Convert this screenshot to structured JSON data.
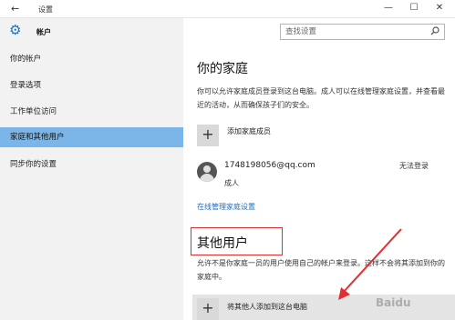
{
  "window": {
    "back_glyph": "←",
    "title": "设置",
    "minimize_glyph": "—",
    "maximize_glyph": "☐",
    "close_glyph": "✕"
  },
  "sidebar": {
    "header_label": "帐户",
    "items": [
      {
        "label": "你的帐户",
        "active": false
      },
      {
        "label": "登录选项",
        "active": false
      },
      {
        "label": "工作单位访问",
        "active": false
      },
      {
        "label": "家庭和其他用户",
        "active": true
      },
      {
        "label": "同步你的设置",
        "active": false
      }
    ]
  },
  "search": {
    "placeholder": "查找设置",
    "icon": "search-icon"
  },
  "family": {
    "title": "你的家庭",
    "description": "你可以允许家庭成员登录到这台电脑。成人可以在线管理家庭设置，并查看最近的活动，从而确保孩子们的安全。",
    "add_label": "添加家庭成员",
    "add_glyph": "+",
    "account": {
      "email": "1748198056@qq.com",
      "role": "成人",
      "status": "无法登录"
    },
    "manage_link": "在线管理家庭设置"
  },
  "others": {
    "title": "其他用户",
    "description": "允许不是你家庭一员的用户使用自己的帐户来登录。这样不会将其添加到你的家庭中。",
    "add_label": "将其他人添加到这台电脑",
    "add_glyph": "+"
  },
  "watermark": "Baidu",
  "colors": {
    "accent": "#1a73c8",
    "active_item": "#7cb6e8",
    "annotation": "#e03030",
    "link": "#1a6dc8"
  }
}
